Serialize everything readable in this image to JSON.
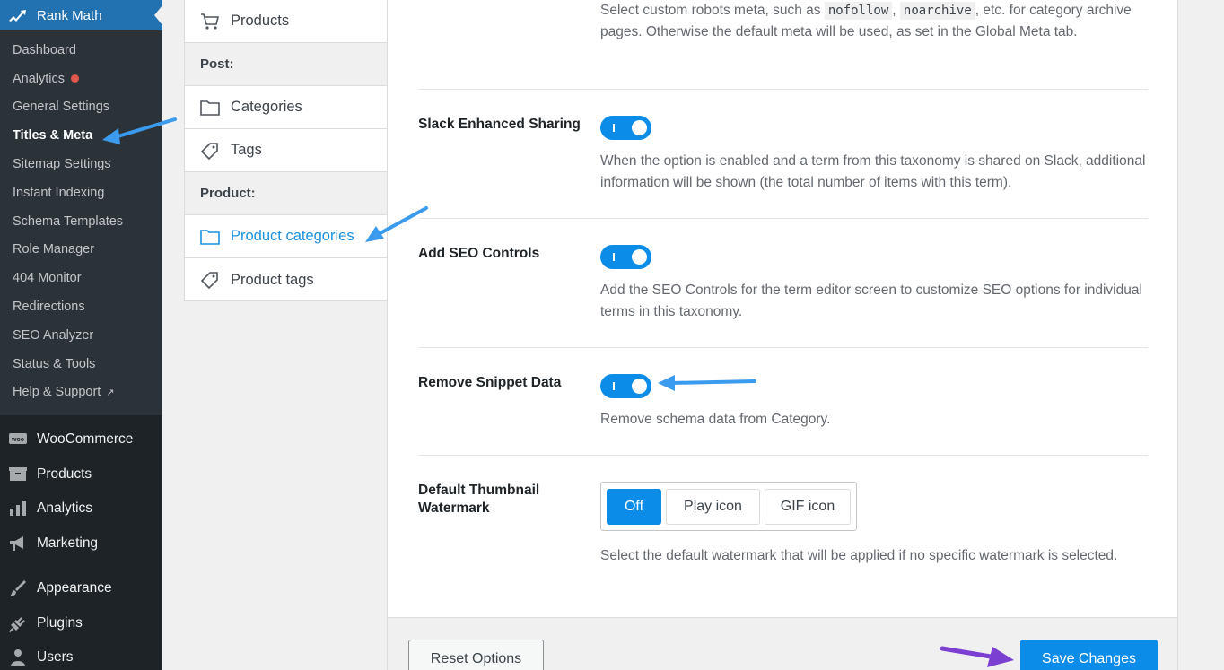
{
  "sidebar": {
    "brand": "Rank Math",
    "submenu": [
      {
        "label": "Dashboard"
      },
      {
        "label": "Analytics",
        "badge": true
      },
      {
        "label": "General Settings"
      },
      {
        "label": "Titles & Meta",
        "active": true
      },
      {
        "label": "Sitemap Settings"
      },
      {
        "label": "Instant Indexing"
      },
      {
        "label": "Schema Templates"
      },
      {
        "label": "Role Manager"
      },
      {
        "label": "404 Monitor"
      },
      {
        "label": "Redirections"
      },
      {
        "label": "SEO Analyzer"
      },
      {
        "label": "Status & Tools"
      },
      {
        "label": "Help & Support",
        "external": true
      }
    ],
    "main_items": [
      {
        "label": "WooCommerce",
        "icon": "woocommerce-icon"
      },
      {
        "label": "Products",
        "icon": "products-icon"
      },
      {
        "label": "Analytics",
        "icon": "analytics-bars-icon"
      },
      {
        "label": "Marketing",
        "icon": "megaphone-icon"
      },
      {
        "label": "Appearance",
        "icon": "brush-icon"
      },
      {
        "label": "Plugins",
        "icon": "plug-icon"
      },
      {
        "label": "Users",
        "icon": "user-icon"
      }
    ]
  },
  "subnav": {
    "items": [
      {
        "label": "Products",
        "icon": "cart-icon"
      },
      {
        "heading": "Post:"
      },
      {
        "label": "Categories",
        "icon": "folder-icon"
      },
      {
        "label": "Tags",
        "icon": "tag-icon"
      },
      {
        "heading": "Product:"
      },
      {
        "label": "Product categories",
        "icon": "folder-icon",
        "active": true
      },
      {
        "label": "Product tags",
        "icon": "tag-icon"
      }
    ]
  },
  "settings": {
    "robots_desc_pre": "Select custom robots meta, such as ",
    "robots_code1": "nofollow",
    "robots_comma": ", ",
    "robots_code2": "noarchive",
    "robots_desc_post": ", etc. for category archive pages. Otherwise the default meta will be used, as set in the Global Meta tab.",
    "slack": {
      "label": "Slack Enhanced Sharing",
      "enabled": true,
      "desc": "When the option is enabled and a term from this taxonomy is shared on Slack, additional information will be shown (the total number of items with this term)."
    },
    "seo_controls": {
      "label": "Add SEO Controls",
      "enabled": true,
      "desc": "Add the SEO Controls for the term editor screen to customize SEO options for individual terms in this taxonomy."
    },
    "snippet": {
      "label": "Remove Snippet Data",
      "enabled": true,
      "desc": "Remove schema data from Category."
    },
    "watermark": {
      "label": "Default Thumbnail Watermark",
      "options": [
        "Off",
        "Play icon",
        "GIF icon"
      ],
      "selected": "Off",
      "desc": "Select the default watermark that will be applied if no specific watermark is selected."
    }
  },
  "footer": {
    "reset_label": "Reset Options",
    "save_label": "Save Changes"
  },
  "colors": {
    "accent": "#0c8ce9",
    "sidebar_bg": "#1d2327",
    "annotation_blue": "#3b9bee",
    "annotation_purple": "#7b3fd1"
  }
}
